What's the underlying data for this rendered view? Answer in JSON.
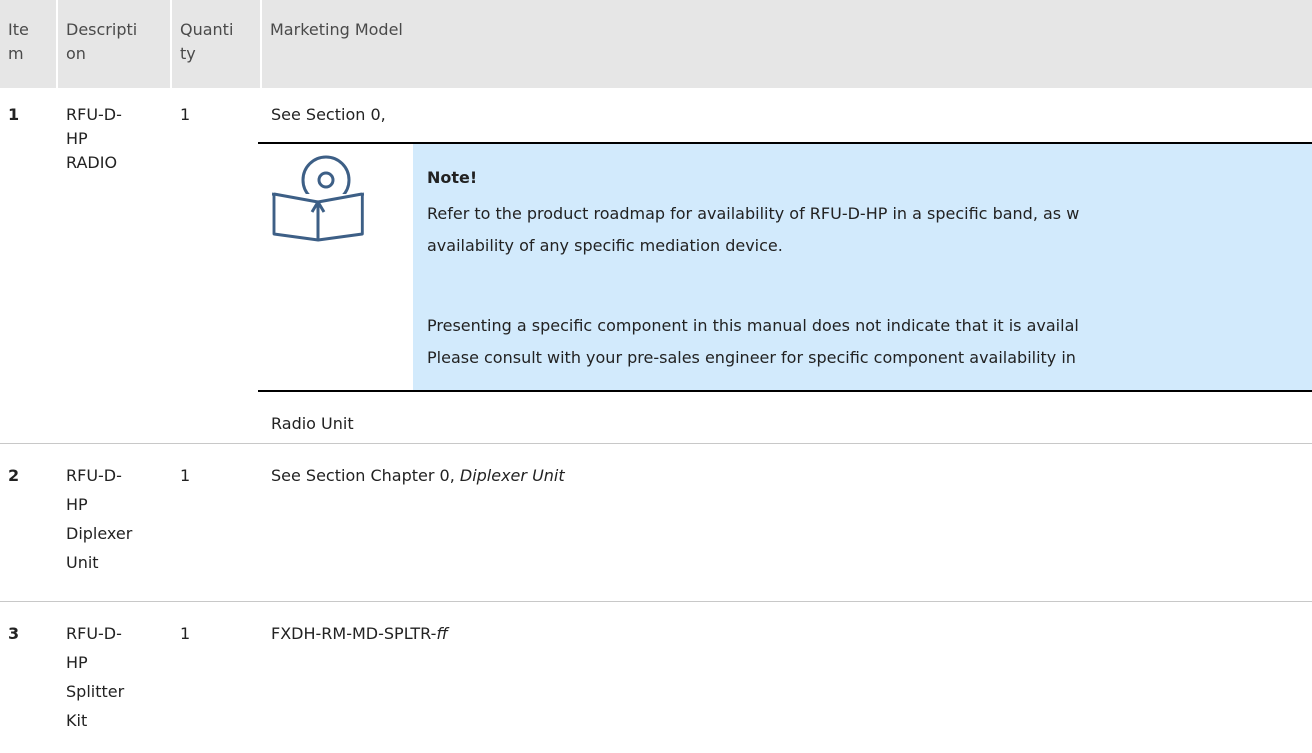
{
  "header": {
    "item": "Ite\nm",
    "description": "Descripti\non",
    "quantity": "Quanti\nty",
    "marketing_model": "Marketing Model"
  },
  "rows": [
    {
      "item": "1",
      "description": "RFU-D-\nHP\nRADIO",
      "quantity": "1",
      "model_prefix": "See Section 0,",
      "note": {
        "title": "Note!",
        "para1": "Refer to the product roadmap for availability of RFU-D-HP in a specific band, as w\navailability of any specific mediation device.",
        "para2": "Presenting a specific component in this manual does not indicate that it is availal\nPlease consult with your pre-sales engineer for specific component availability in"
      },
      "model_suffix": "Radio Unit"
    },
    {
      "item": "2",
      "description": "RFU-D-\nHP\nDiplexer\nUnit",
      "quantity": "1",
      "model_text": "See Section Chapter 0, ",
      "model_italic": "Diplexer Unit"
    },
    {
      "item": "3",
      "description": "RFU-D-\nHP\nSplitter\nKit",
      "quantity": "1",
      "model_text": "FXDH-RM-MD-SPLTR-",
      "model_italic": "ff"
    }
  ],
  "icons": {
    "note": "book-cd-icon"
  },
  "colors": {
    "header_bg": "#e6e6e6",
    "note_bg": "#d2eafc",
    "icon_stroke": "#3d5f86"
  }
}
